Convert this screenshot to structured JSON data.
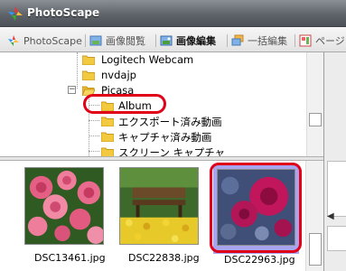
{
  "app": {
    "title": "PhotoScape"
  },
  "tabs": [
    {
      "label": "PhotoScape",
      "active": false
    },
    {
      "label": "画像閲覧",
      "active": false
    },
    {
      "label": "画像編集",
      "active": true
    },
    {
      "label": "一括編集",
      "active": false
    },
    {
      "label": "ページ",
      "active": false
    }
  ],
  "folder_tree": {
    "items": [
      {
        "label": "Logitech Webcam"
      },
      {
        "label": "nvdajp"
      },
      {
        "label": "Picasa",
        "expanded": true
      },
      {
        "label": "Album",
        "highlighted": true
      },
      {
        "label": "エクスポート済み動画"
      },
      {
        "label": "キャプチャ済み動画"
      },
      {
        "label": "スクリーン キャプチャ"
      }
    ]
  },
  "thumbnails": [
    {
      "filename": "DSC13461.jpg",
      "subject": "pink-roses",
      "selected": false
    },
    {
      "filename": "DSC22838.jpg",
      "subject": "garden-bench",
      "selected": false
    },
    {
      "filename": "DSC22963.jpg",
      "subject": "red-roses",
      "selected": true
    }
  ],
  "colors": {
    "highlight_ring": "#e00018",
    "selection_bg": "#a9a4ee",
    "folder": "#f3c940"
  }
}
